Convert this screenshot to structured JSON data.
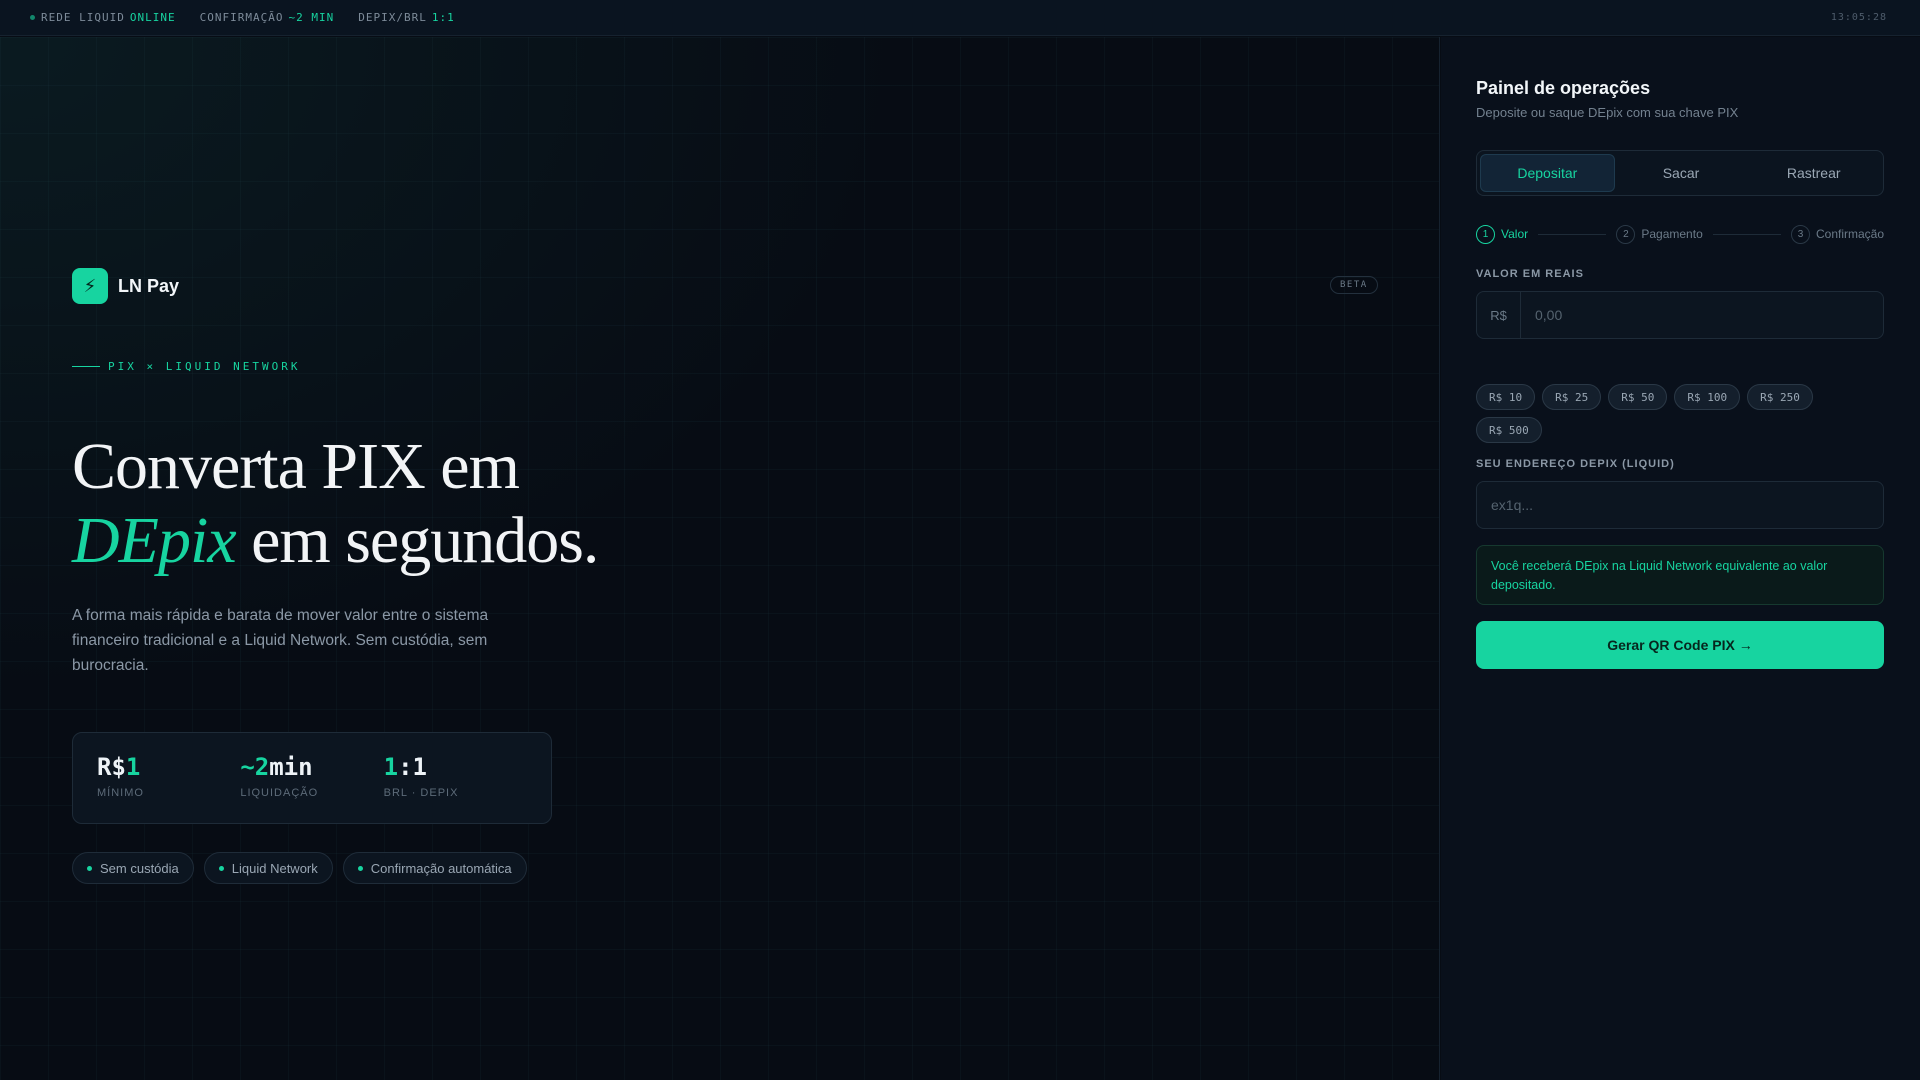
{
  "topbar": {
    "network_label": "REDE LIQUID",
    "network_status": "ONLINE",
    "confirm_label": "CONFIRMAÇÃO",
    "confirm_value": "~2 MIN",
    "pair_label": "DEPIX/BRL",
    "pair_value": "1:1",
    "clock": "13:05:28"
  },
  "brand": {
    "name": "LN Pay",
    "logo_glyph": "⚡",
    "badge": "BETA"
  },
  "hero": {
    "eyebrow": "PIX × LIQUID NETWORK",
    "headline_line1": "Converta PIX em",
    "headline_accent": "DEpix",
    "headline_line2_rest": " em segundos.",
    "lead": "A forma mais rápida e barata de mover valor entre o sistema financeiro tradicional e a Liquid Network. Sem custódia, sem burocracia."
  },
  "stats": [
    {
      "prefix": "R$",
      "highlight": "1",
      "suffix": "",
      "label": "MÍNIMO"
    },
    {
      "prefix": "",
      "highlight": "~2",
      "suffix": "min",
      "label": "LIQUIDAÇÃO"
    },
    {
      "prefix": "",
      "highlight": "1",
      "suffix": ":1",
      "label": "BRL · DEPIX"
    }
  ],
  "chips": [
    "Sem custódia",
    "Liquid Network",
    "Confirmação automática"
  ],
  "panel": {
    "title": "Painel de operações",
    "subtitle": "Deposite ou saque DEpix com sua chave PIX",
    "tabs": [
      "Depositar",
      "Sacar",
      "Rastrear"
    ],
    "active_tab": "Depositar",
    "steps": [
      {
        "num": "1",
        "label": "Valor"
      },
      {
        "num": "2",
        "label": "Pagamento"
      },
      {
        "num": "3",
        "label": "Confirmação"
      }
    ],
    "amount_label": "VALOR EM REAIS",
    "currency_prefix": "R$",
    "amount_placeholder": "0,00",
    "presets": [
      "R$ 10",
      "R$ 25",
      "R$ 50",
      "R$ 100",
      "R$ 250",
      "R$ 500"
    ],
    "address_label": "SEU ENDEREÇO DEPIX (LIQUID)",
    "address_placeholder": "ex1q...",
    "notice": "Você receberá DEpix na Liquid Network equivalente ao valor depositado.",
    "cta": "Gerar QR Code PIX →"
  },
  "colors": {
    "accent": "#17d4a0",
    "background": "#070c14",
    "panel": "#09101b"
  }
}
